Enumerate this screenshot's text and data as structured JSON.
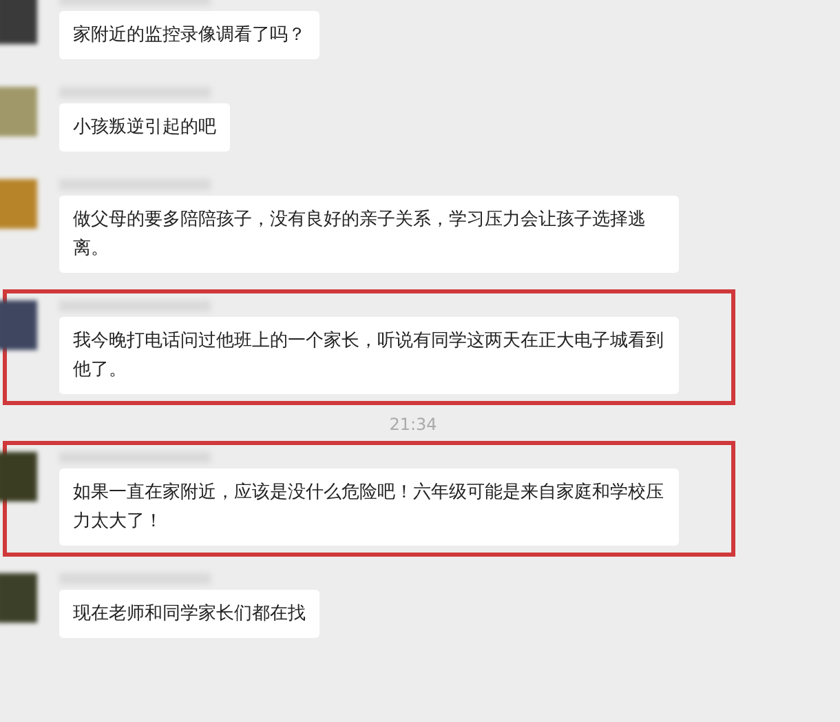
{
  "messages": [
    {
      "kind": "message",
      "color": "#3a3a3a",
      "highlighted": false,
      "text": "家附近的监控录像调看了吗？"
    },
    {
      "kind": "message",
      "color": "#a09868",
      "highlighted": false,
      "text": "小孩叛逆引起的吧"
    },
    {
      "kind": "message",
      "color": "#b8842a",
      "highlighted": false,
      "text": "做父母的要多陪陪孩子，没有良好的亲子关系，学习压力会让孩子选择逃离。"
    },
    {
      "kind": "message",
      "color": "#3e4660",
      "highlighted": true,
      "text": "我今晚打电话问过他班上的一个家长，听说有同学这两天在正大电子城看到他了。"
    },
    {
      "kind": "time",
      "text": "21:34"
    },
    {
      "kind": "message",
      "color": "#3a3d22",
      "highlighted": true,
      "text": "如果一直在家附近，应该是没什么危险吧！六年级可能是来自家庭和学校压力太大了！"
    },
    {
      "kind": "message",
      "color": "#3c4028",
      "highlighted": false,
      "text": "现在老师和同学家长们都在找"
    }
  ]
}
